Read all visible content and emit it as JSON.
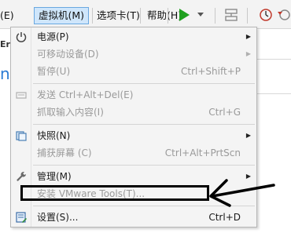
{
  "menubar": {
    "items": [
      {
        "label": "(E)"
      },
      {
        "label": "虚拟机(M)"
      },
      {
        "label": "选项卡(T)"
      },
      {
        "label": "帮助(H)"
      }
    ]
  },
  "background": {
    "tab_text": "Er",
    "blue_text": "nt"
  },
  "menu": {
    "items": [
      {
        "label": "电源(P)",
        "shortcut": "",
        "disabled": false,
        "submenu": true,
        "icon": "power-icon"
      },
      {
        "label": "可移动设备(D)",
        "shortcut": "",
        "disabled": true,
        "submenu": true,
        "icon": ""
      },
      {
        "label": "暂停(U)",
        "shortcut": "Ctrl+Shift+P",
        "disabled": true,
        "submenu": false,
        "icon": ""
      },
      {
        "label": "发送 Ctrl+Alt+Del(E)",
        "shortcut": "",
        "disabled": true,
        "submenu": false,
        "icon": "send-keys-icon"
      },
      {
        "label": "抓取输入内容(I)",
        "shortcut": "Ctrl+G",
        "disabled": true,
        "submenu": false,
        "icon": ""
      },
      {
        "label": "快照(N)",
        "shortcut": "",
        "disabled": false,
        "submenu": true,
        "icon": "snapshot-icon"
      },
      {
        "label": "捕获屏幕 (C)",
        "shortcut": "Ctrl+Alt+PrtScn",
        "disabled": true,
        "submenu": false,
        "icon": ""
      },
      {
        "label": "管理(M)",
        "shortcut": "",
        "disabled": false,
        "submenu": true,
        "icon": "wrench-icon"
      },
      {
        "label": "安装 VMware Tools(T)...",
        "shortcut": "",
        "disabled": true,
        "submenu": false,
        "icon": ""
      },
      {
        "label": "设置(S)...",
        "shortcut": "Ctrl+D",
        "disabled": false,
        "submenu": false,
        "icon": "settings-icon"
      }
    ]
  },
  "colors": {
    "accent": "#2a7bd4",
    "play_green": "#1fa01f",
    "menu_bg": "#f4f4f4",
    "disabled_text": "#9a9a9a",
    "highlight_border": "#000000"
  }
}
